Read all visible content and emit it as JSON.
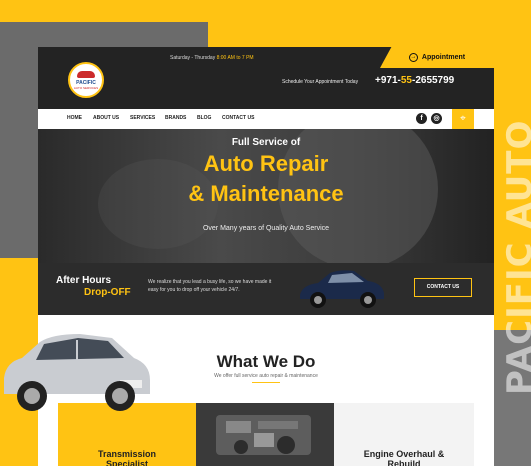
{
  "watermark": "PACIFIC AUTO",
  "logo": {
    "name": "PACIFIC",
    "tagline": "AUTO SERVICES"
  },
  "topbar": {
    "hours_prefix": "Saturday - Thursday ",
    "hours_time": "8:00 AM to 7 PM",
    "appointment_label": "Appointment",
    "schedule_text": "Schedule Your Appointment Today",
    "phone_prefix": "+971-",
    "phone_area": "55",
    "phone_suffix": "-2655799"
  },
  "nav": {
    "items": [
      "HOME",
      "ABOUT US",
      "SERVICES",
      "BRANDS",
      "BLOG",
      "CONTACT US"
    ]
  },
  "hero": {
    "eyebrow": "Full Service of",
    "title_line1": "Auto Repair",
    "title_line2": "& Maintenance",
    "subtitle": "Over Many years of Quality Auto Service"
  },
  "after_hours": {
    "title1": "After Hours",
    "title2": "Drop-OFF",
    "description": "We realize that you lead a busy life, so we have made it easy for you to drop off your vehicle 24/7.",
    "button_label": "CONTACT US"
  },
  "what_we_do": {
    "title": "What We Do",
    "subtitle": "We offer full service auto repair & maintenance",
    "cards": [
      {
        "title": "Transmission Specialist"
      },
      {
        "title": ""
      },
      {
        "title": "Engine Overhaul & Rebuild"
      }
    ]
  },
  "colors": {
    "accent": "#ffc313",
    "dark": "#232323"
  },
  "icons": {
    "social": [
      "facebook-icon",
      "instagram-icon"
    ],
    "location": "map-pin-icon"
  }
}
